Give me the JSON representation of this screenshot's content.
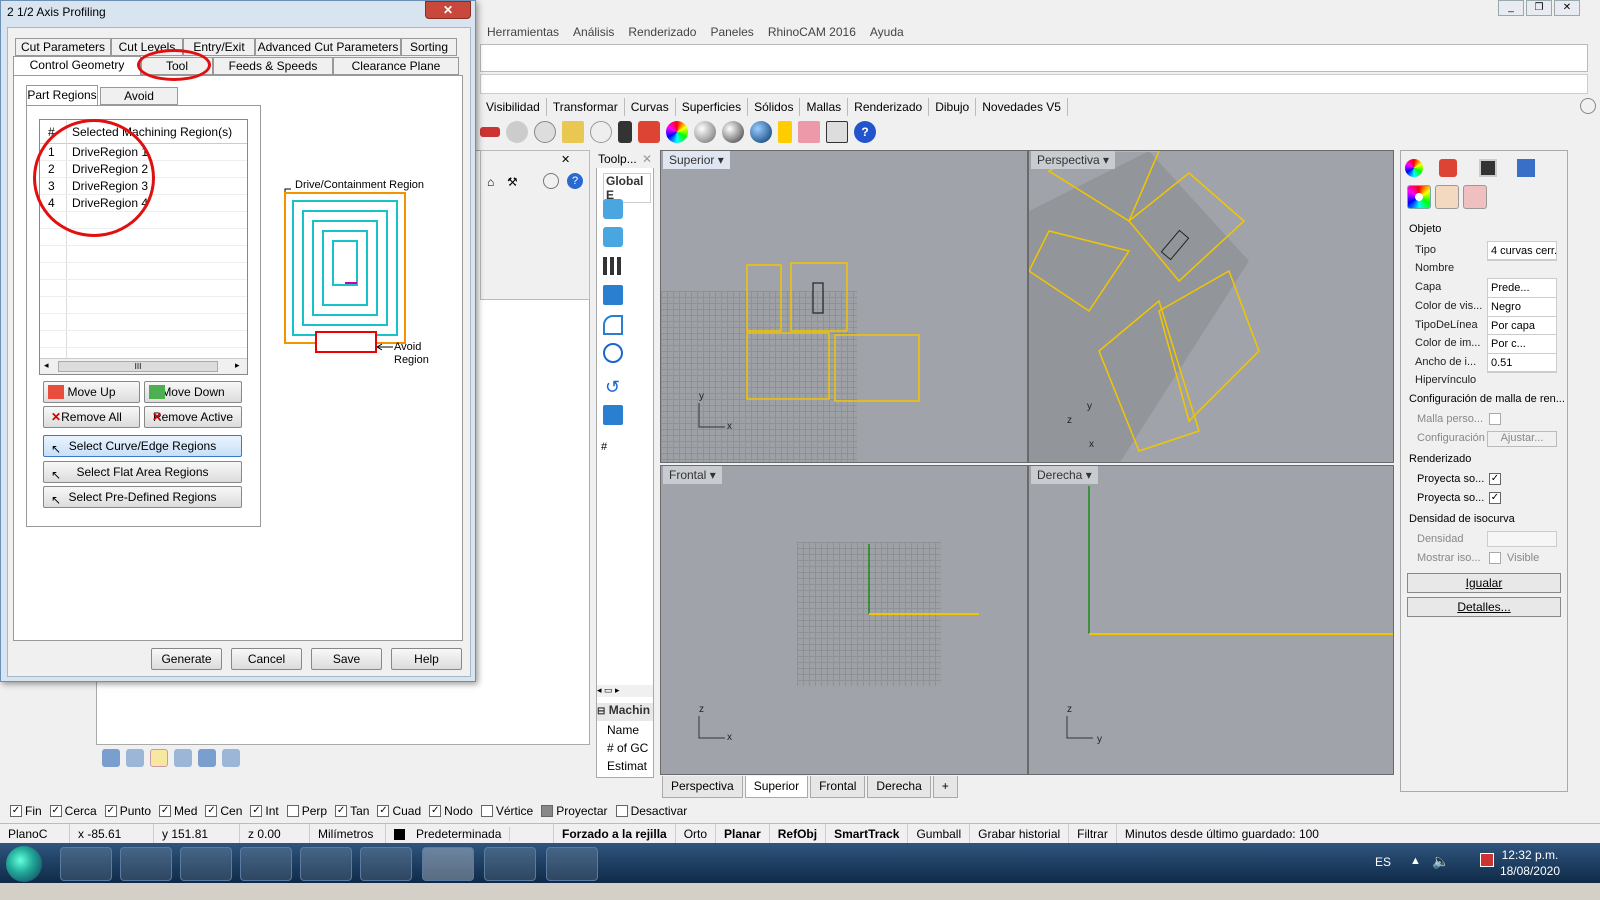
{
  "rhino": {
    "menu": [
      "Herramientas",
      "Análisis",
      "Renderizado",
      "Paneles",
      "RhinoCAM 2016",
      "Ayuda"
    ],
    "toolbar_tabs": [
      "Visibilidad",
      "Transformar",
      "Curvas",
      "Superficies",
      "Sólidos",
      "Mallas",
      "Renderizado",
      "Dibujo",
      "Novedades V5"
    ]
  },
  "toolpath_panel": {
    "title": "Toolp...",
    "tab": "Global E",
    "hash": "#",
    "machine_header": "Machin",
    "rows": [
      "Name",
      "# of GC",
      "Estimat"
    ]
  },
  "viewports": {
    "top": "Superior",
    "perspective": "Perspectiva",
    "front": "Frontal",
    "right": "Derecha",
    "tabs": [
      "Perspectiva",
      "Superior",
      "Frontal",
      "Derecha"
    ],
    "add_tab": "+"
  },
  "properties": {
    "section_object": "Objeto",
    "rows": [
      {
        "k": "Tipo",
        "v": "4 curvas cerr..."
      },
      {
        "k": "Nombre",
        "v": ""
      },
      {
        "k": "Capa",
        "v": "Prede..."
      },
      {
        "k": "Color de vis...",
        "v": "Negro"
      },
      {
        "k": "TipoDeLínea",
        "v": "Por capa"
      },
      {
        "k": "Color de im...",
        "v": "Por c..."
      },
      {
        "k": "Ancho de i...",
        "v": "0.51"
      },
      {
        "k": "Hipervínculo",
        "v": ""
      }
    ],
    "mesh_section": "Configuración de malla de ren...",
    "mesh_custom": "Malla perso...",
    "mesh_config": "Configuración",
    "mesh_adjust": "Ajustar...",
    "render_section": "Renderizado",
    "render_rows": [
      "Proyecta so...",
      "Proyecta so..."
    ],
    "iso_section": "Densidad de isocurva",
    "density": "Densidad",
    "show_iso": "Mostrar iso...",
    "visible": "Visible",
    "match_button": "Igualar",
    "details_button": "Detalles..."
  },
  "osnaps": [
    {
      "label": "Fin",
      "checked": true
    },
    {
      "label": "Cerca",
      "checked": true
    },
    {
      "label": "Punto",
      "checked": true
    },
    {
      "label": "Med",
      "checked": true
    },
    {
      "label": "Cen",
      "checked": true
    },
    {
      "label": "Int",
      "checked": true
    },
    {
      "label": "Perp",
      "checked": false
    },
    {
      "label": "Tan",
      "checked": true
    },
    {
      "label": "Cuad",
      "checked": true
    },
    {
      "label": "Nodo",
      "checked": true
    },
    {
      "label": "Vértice",
      "checked": false
    },
    {
      "label": "Proyectar",
      "checked": false
    },
    {
      "label": "Desactivar",
      "checked": false
    }
  ],
  "status": {
    "cplane": "PlanoC",
    "x": "x -85.61",
    "y": "y 151.81",
    "z": "z 0.00",
    "units": "Milímetros",
    "layer": "Predeterminada",
    "grid_snap": "Forzado a la rejilla",
    "ortho": "Orto",
    "planar": "Planar",
    "osnap": "RefObj",
    "smarttrack": "SmartTrack",
    "gumball": "Gumball",
    "history": "Grabar historial",
    "filter": "Filtrar",
    "last_save": "Minutos desde último guardado: 100"
  },
  "taskbar": {
    "lang": "ES",
    "time": "12:32 p.m.",
    "date": "18/08/2020"
  },
  "dialog": {
    "title": "2 1/2 Axis Profiling",
    "close": "✕",
    "tabs_row1": [
      "Cut Parameters",
      "Cut Levels",
      "Entry/Exit",
      "Advanced Cut Parameters",
      "Sorting"
    ],
    "tabs_row2": [
      "Control Geometry",
      "Tool",
      "Feeds & Speeds",
      "Clearance Plane"
    ],
    "subtabs": [
      "Part Regions",
      "Avoid Regions"
    ],
    "list_header_num": "#",
    "list_header": "Selected Machining Region(s)",
    "regions": [
      {
        "n": "1",
        "name": "DriveRegion 1"
      },
      {
        "n": "2",
        "name": "DriveRegion 2"
      },
      {
        "n": "3",
        "name": "DriveRegion 3"
      },
      {
        "n": "4",
        "name": "DriveRegion 4"
      }
    ],
    "scroll_thumb": "III",
    "buttons": {
      "move_up": "Move Up",
      "move_down": "Move Down",
      "remove_all": "Remove All",
      "remove_active": "Remove Active",
      "select_curve": "Select Curve/Edge Regions",
      "select_flat": "Select Flat Area Regions",
      "select_predef": "Select Pre-Defined Regions"
    },
    "diagram": {
      "drive_label": "Drive/Containment Region",
      "avoid_label": "Avoid",
      "avoid_label2": "Region"
    },
    "footer": [
      "Generate",
      "Cancel",
      "Save",
      "Help"
    ]
  }
}
